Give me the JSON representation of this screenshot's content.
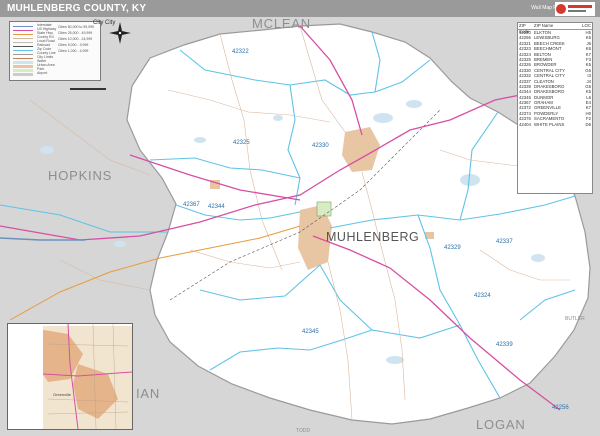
{
  "header": {
    "title": "MUHLENBERG COUNTY, KY",
    "edition": "Wall Map Premium Edition"
  },
  "colors": {
    "title_bar": "#9a9a9a",
    "outside_county": "#d6d6d6",
    "county_fill": "#ffffff",
    "zip_boundary": "#5fc3e6",
    "interstate": "#6f8fbf",
    "highway": "#d64fa3",
    "urban": "#e8c6a4",
    "water": "#cfe4f0",
    "zip_label": "#2b6fa8"
  },
  "legend": {
    "rows": [
      "Interstate",
      "US Highway",
      "State Hwy",
      "County Rd",
      "Local Road",
      "Railroad",
      "Zip Code",
      "County Line",
      "City Limits",
      "Water",
      "Urban Area",
      "Park",
      "Airport"
    ],
    "right_rows": [
      "Cities 50,000 to 99,999",
      "Cities 25,000 - 49,999",
      "Cities 10,000 - 24,999",
      "Cities 5,000 - 9,999",
      "Cities 1,000 - 4,999"
    ],
    "city_title": "City City"
  },
  "labels": {
    "main_county": "MUHLENBERG",
    "neighbors": [
      "MCLEAN",
      "HOPKINS",
      "LOGAN",
      "BUTLER",
      "TODD",
      "CHRISTIAN",
      "IAN"
    ]
  },
  "zip_labels": [
    "42322",
    "42330",
    "42325",
    "42344",
    "42337",
    "42329",
    "42367",
    "42324",
    "42345",
    "42339",
    "42256"
  ],
  "zip_table": {
    "headers": [
      "ZIP Code",
      "ZIP Name",
      "LOC"
    ],
    "rows": [
      [
        "42220",
        "ELKTON",
        "H5"
      ],
      [
        "42256",
        "LEWISBURG",
        "K6"
      ],
      [
        "42321",
        "BEECH CREEK",
        "J6"
      ],
      [
        "42323",
        "BEECHMONT",
        "K6"
      ],
      [
        "42324",
        "BELTON",
        "K7"
      ],
      [
        "42325",
        "BREMEN",
        "F3"
      ],
      [
        "42326",
        "BROWDER",
        "K5"
      ],
      [
        "42330",
        "CENTRAL CITY",
        "G6"
      ],
      [
        "42332",
        "CENTRAL CITY",
        "I3"
      ],
      [
        "42337",
        "CLEATON",
        "J4"
      ],
      [
        "42339",
        "DRAKESBORO",
        "G5"
      ],
      [
        "42344",
        "DRAKESBORO",
        "K5"
      ],
      [
        "42345",
        "DUNMOR",
        "L6"
      ],
      [
        "42367",
        "GRAHAM",
        "E4"
      ],
      [
        "42372",
        "GREENVILLE",
        "K7"
      ],
      [
        "42374",
        "POWDERLY",
        "H0"
      ],
      [
        "42376",
        "SACRAMENTO",
        "F2"
      ],
      [
        "42404",
        "WHITE PLAINS",
        "D6"
      ]
    ]
  },
  "icons": [
    "compass-icon",
    "company-logo-icon"
  ]
}
